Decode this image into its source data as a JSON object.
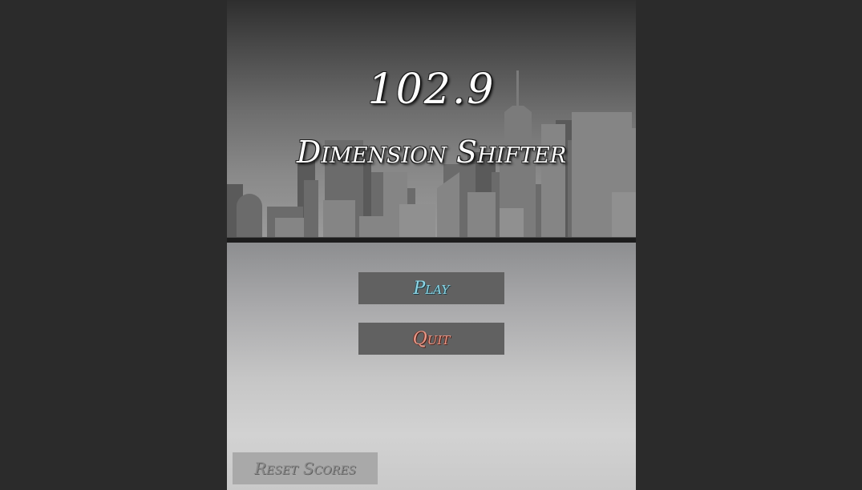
{
  "game": {
    "title_number": "102.9",
    "title_name": "Dimension Shifter"
  },
  "menu": {
    "play_label": "Play",
    "quit_label": "Quit",
    "reset_scores_label": "Reset Scores"
  },
  "colors": {
    "outer_background": "#2b2b2b",
    "play_text": "#8fd6e6",
    "quit_text": "#e89a8a",
    "button_background": "#616161",
    "reset_button_background": "#a9a9a9"
  },
  "icons": {
    "skyline": "city-skyline-icon"
  }
}
